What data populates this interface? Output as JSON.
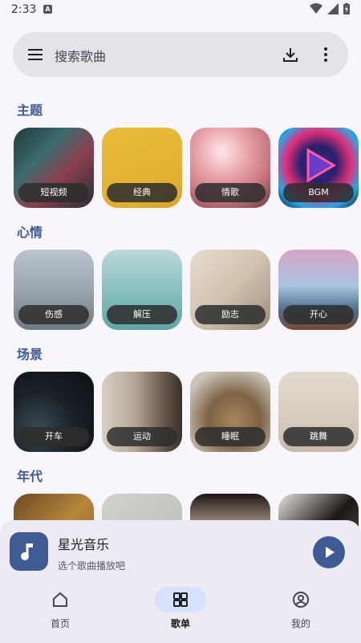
{
  "status": {
    "time": "2:33",
    "notif": "A"
  },
  "search": {
    "placeholder": "搜索歌曲"
  },
  "sections": [
    {
      "title": "主题",
      "cards": [
        "短视频",
        "经典",
        "情歌",
        "BGM"
      ]
    },
    {
      "title": "心情",
      "cards": [
        "伤感",
        "解压",
        "励志",
        "开心"
      ]
    },
    {
      "title": "场景",
      "cards": [
        "开车",
        "运动",
        "睡眠",
        "跳舞"
      ]
    },
    {
      "title": "年代",
      "cards": [
        "",
        "",
        "",
        ""
      ]
    }
  ],
  "player": {
    "title": "星光音乐",
    "subtitle": "选个歌曲播放吧"
  },
  "nav": {
    "home": "首页",
    "playlist": "歌单",
    "mine": "我的"
  },
  "colors": {
    "accent": "#3f5b94",
    "background": "#f8f5fc",
    "active_pill": "#d6e1fb"
  }
}
